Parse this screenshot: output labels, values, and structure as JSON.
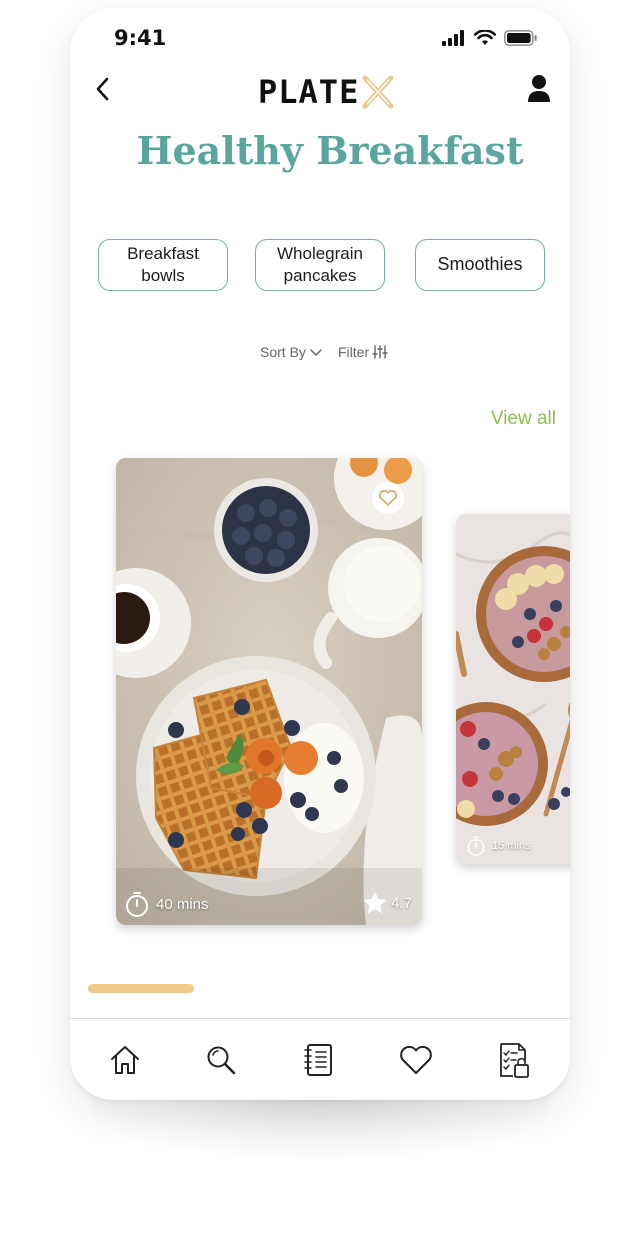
{
  "status_bar": {
    "time": "9:41"
  },
  "header": {
    "logo_text": "PLATE",
    "title": "Healthy Breakfast"
  },
  "chips": [
    {
      "label": "Breakfast\nbowls"
    },
    {
      "label": "Wholegrain\npancakes"
    },
    {
      "label": "Smoothies"
    }
  ],
  "controls": {
    "sort_label": "Sort By",
    "filter_label": "Filter"
  },
  "section": {
    "view_all": "View all"
  },
  "cards": [
    {
      "time": "40 mins",
      "rating": "4.7",
      "favorite": false
    },
    {
      "time": "15 mins"
    }
  ],
  "tab_bar": {
    "tabs": [
      {
        "icon": "home-icon"
      },
      {
        "icon": "search-icon"
      },
      {
        "icon": "recipe-book-icon"
      },
      {
        "icon": "heart-icon"
      },
      {
        "icon": "shopping-list-icon"
      }
    ]
  },
  "colors": {
    "accent": "#5aa69e",
    "chip_border": "#6fb3aa",
    "view_all": "#8dbf4c",
    "indicator": "#efc98a"
  }
}
